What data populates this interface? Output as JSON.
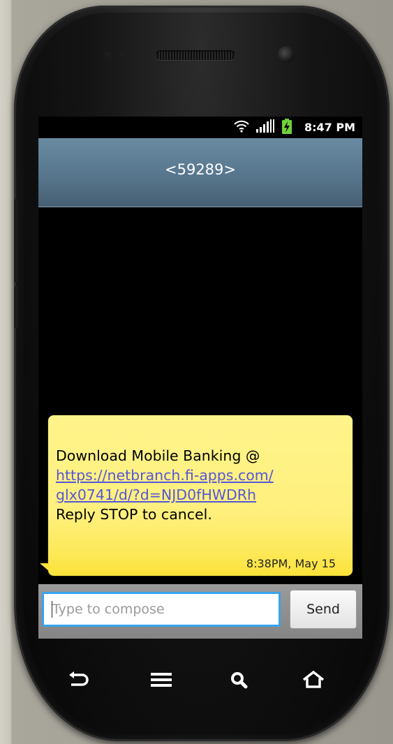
{
  "status_bar": {
    "time": "8:47 PM",
    "icons": [
      "wifi-icon",
      "signal-icon",
      "battery-charging-icon"
    ]
  },
  "conversation": {
    "title": "<59289>"
  },
  "message": {
    "text_line1": "Download Mobile Banking @",
    "link_line1": "https://netbranch.fi-apps.com/",
    "link_line2": "glx0741/d/?d=NJD0fHWDRh",
    "text_line2": "Reply STOP to cancel.",
    "timestamp": "8:38PM, May 15"
  },
  "compose": {
    "placeholder": "Type to compose",
    "value": "",
    "send_label": "Send"
  },
  "nav_keys": [
    "back-icon",
    "menu-icon",
    "search-icon",
    "home-icon"
  ],
  "colors": {
    "title_bar": "#57768d",
    "bubble": "#fff07e",
    "link": "#5656d8",
    "input_focus": "#36a3ef"
  }
}
